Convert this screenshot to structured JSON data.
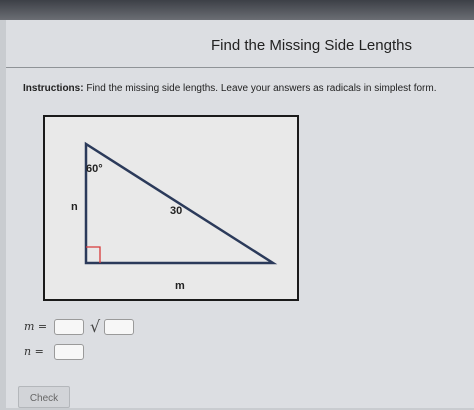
{
  "header": {
    "title": "Find the Missing Side Lengths"
  },
  "instructions": {
    "label": "Instructions:",
    "text": " Find the missing side lengths. Leave your answers as radicals in simplest form."
  },
  "figure": {
    "angle_label": "60°",
    "hypotenuse_label": "30",
    "left_side_label": "n",
    "bottom_side_label": "m"
  },
  "answers": {
    "m_label": "m =",
    "n_label": "n =",
    "sqrt_symbol": "√",
    "m_coefficient": "",
    "m_radicand": "",
    "n_value": ""
  },
  "actions": {
    "check_label": "Check"
  },
  "colors": {
    "right_angle_marker": "#d83a3a",
    "panel_bg": "#dcdee2"
  }
}
